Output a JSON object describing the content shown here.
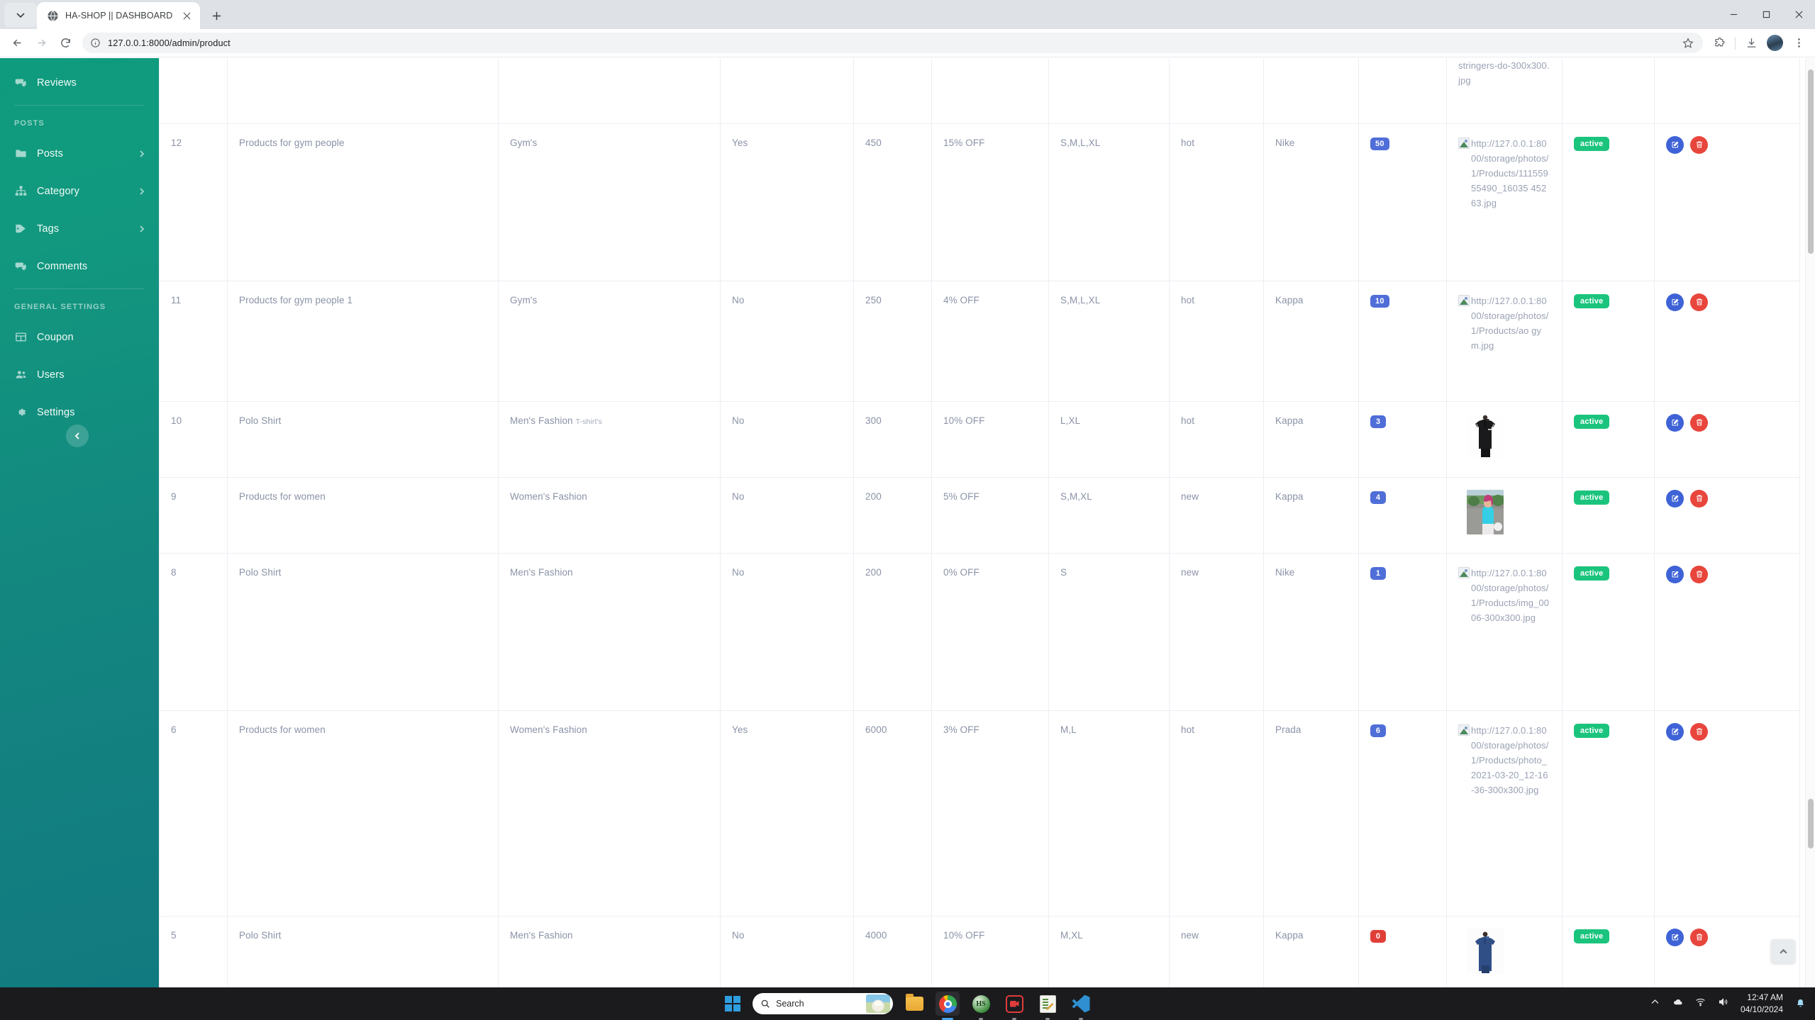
{
  "browser": {
    "tab_title": "HA-SHOP || DASHBOARD",
    "url": "127.0.0.1:8000/admin/product",
    "new_tab_label": "+",
    "close_label": "×"
  },
  "sidebar": {
    "items": [
      {
        "label": "Reviews",
        "icon": "comments-icon",
        "caret": false
      },
      {
        "label": "Posts",
        "icon": "folder-icon",
        "caret": true
      },
      {
        "label": "Category",
        "icon": "sitemap-icon",
        "caret": true
      },
      {
        "label": "Tags",
        "icon": "tag-icon",
        "caret": true
      },
      {
        "label": "Comments",
        "icon": "comments-icon",
        "caret": false
      },
      {
        "label": "Coupon",
        "icon": "table-icon",
        "caret": false
      },
      {
        "label": "Users",
        "icon": "users-icon",
        "caret": false
      },
      {
        "label": "Settings",
        "icon": "gear-icon",
        "caret": false
      }
    ],
    "section_posts": "POSTS",
    "section_general": "GENERAL SETTINGS"
  },
  "table": {
    "rows": [
      {
        "id": "",
        "name": "",
        "category": "",
        "subcategory": "",
        "featured": "",
        "price": "",
        "discount": "",
        "size": "",
        "condition": "",
        "brand": "",
        "qty": "",
        "qty_zero": false,
        "image_type": "broken",
        "image_text": "stringers-do-300x300.jpg",
        "status": "",
        "partial": true
      },
      {
        "id": "12",
        "name": "Products for gym people",
        "category": "Gym's",
        "subcategory": "",
        "featured": "Yes",
        "price": "450",
        "discount": "15% OFF",
        "size": "S,M,L,XL",
        "condition": "hot",
        "brand": "Nike",
        "qty": "50",
        "qty_zero": false,
        "image_type": "broken",
        "image_text": "http://127.0.0.1:8000/storage/photos/1/Products/11155955490_16035 45263.jpg",
        "status": "active",
        "partial": false
      },
      {
        "id": "11",
        "name": "Products for gym people 1",
        "category": "Gym's",
        "subcategory": "",
        "featured": "No",
        "price": "250",
        "discount": "4% OFF",
        "size": "S,M,L,XL",
        "condition": "hot",
        "brand": "Kappa",
        "qty": "10",
        "qty_zero": false,
        "image_type": "broken",
        "image_text": "http://127.0.0.1:8000/storage/photos/1/Products/ao gym.jpg",
        "status": "active",
        "partial": false
      },
      {
        "id": "10",
        "name": "Polo Shirt",
        "category": "Men's Fashion",
        "subcategory": "T-shirt's",
        "featured": "No",
        "price": "300",
        "discount": "10% OFF",
        "size": "L,XL",
        "condition": "hot",
        "brand": "Kappa",
        "qty": "3",
        "qty_zero": false,
        "image_type": "photo-black-polo",
        "image_text": "",
        "status": "active",
        "partial": false
      },
      {
        "id": "9",
        "name": "Products for women",
        "category": "Women's Fashion",
        "subcategory": "",
        "featured": "No",
        "price": "200",
        "discount": "5% OFF",
        "size": "S,M,XL",
        "condition": "new",
        "brand": "Kappa",
        "qty": "4",
        "qty_zero": false,
        "image_type": "photo-woman-cyan",
        "image_text": "",
        "status": "active",
        "partial": false
      },
      {
        "id": "8",
        "name": "Polo Shirt",
        "category": "Men's Fashion",
        "subcategory": "",
        "featured": "No",
        "price": "200",
        "discount": "0% OFF",
        "size": "S",
        "condition": "new",
        "brand": "Nike",
        "qty": "1",
        "qty_zero": false,
        "image_type": "broken",
        "image_text": "http://127.0.0.1:8000/storage/photos/1/Products/img_0006-300x300.jpg",
        "status": "active",
        "partial": false
      },
      {
        "id": "6",
        "name": "Products for women",
        "category": "Women's Fashion",
        "subcategory": "",
        "featured": "Yes",
        "price": "6000",
        "discount": "3% OFF",
        "size": "M,L",
        "condition": "hot",
        "brand": "Prada",
        "qty": "6",
        "qty_zero": false,
        "image_type": "broken",
        "image_text": "http://127.0.0.1:8000/storage/photos/1/Products/photo_2021-03-20_12-16-36-300x300.jpg",
        "status": "active",
        "partial": false
      },
      {
        "id": "5",
        "name": "Polo Shirt",
        "category": "Men's Fashion",
        "subcategory": "",
        "featured": "No",
        "price": "4000",
        "discount": "10% OFF",
        "size": "M,XL",
        "condition": "new",
        "brand": "Kappa",
        "qty": "0",
        "qty_zero": true,
        "image_type": "photo-blue-polo",
        "image_text": "",
        "status": "active",
        "partial": false
      }
    ]
  },
  "taskbar": {
    "search_placeholder": "Search",
    "time": "12:47 AM",
    "date": "04/10/2024",
    "apps": [
      "file-explorer-icon",
      "chrome-icon",
      "hs-app-icon",
      "screen-recorder-icon",
      "notepad-icon",
      "vscode-icon"
    ]
  },
  "colors": {
    "sidebar_start": "#0f9b7d",
    "sidebar_end": "#117a80",
    "badge_blue": "#4f6ed8",
    "badge_red": "#e03e38",
    "status_green": "#1bc47d",
    "edit_blue": "#3f63d6",
    "delete_red": "#e8453c"
  }
}
